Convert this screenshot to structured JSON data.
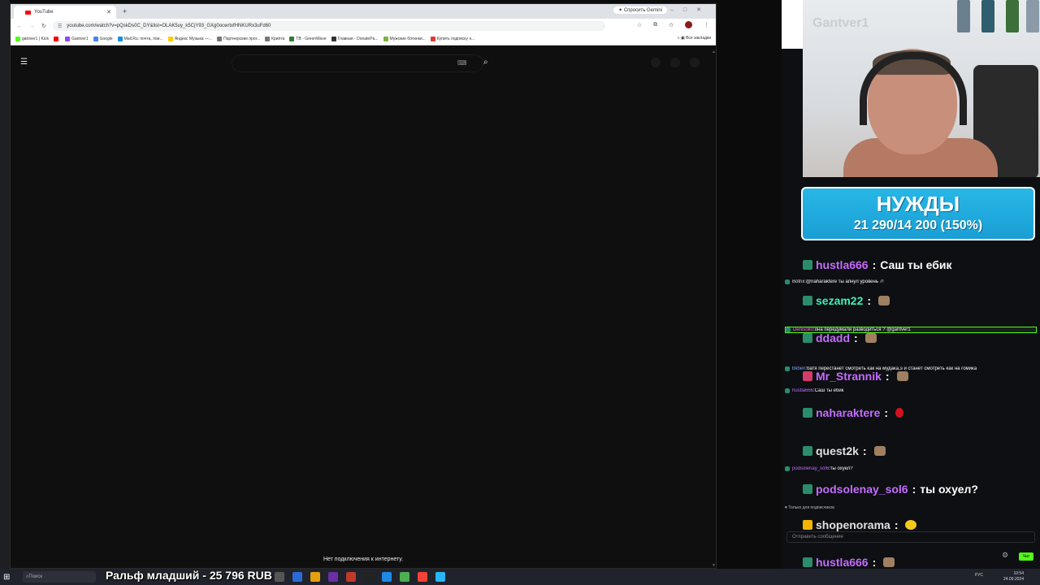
{
  "browser": {
    "tab_title": "YouTube",
    "url": "youtube.com/watch?v=pQskDs0C_DY&list=OLAK5uy_k5CjY93_GXg0ocwrtxfHNKURx3uFd60",
    "gemini_label": "Спросить Gemini",
    "all_bookmarks": "Все закладки",
    "bookmarks": [
      {
        "label": "gantver1 | Kick",
        "color": "#53fc18"
      },
      {
        "label": "",
        "color": "#ff0000"
      },
      {
        "label": "Gantver1",
        "color": "#9146ff"
      },
      {
        "label": "Google",
        "color": "#4285f4"
      },
      {
        "label": "Mail.Ru: почта, пои...",
        "color": "#168de2"
      },
      {
        "label": "Яндекс Музыка —...",
        "color": "#ffcc00"
      },
      {
        "label": "Партнерские прог...",
        "color": "#777777"
      },
      {
        "label": "Крипта",
        "color": "#777777"
      },
      {
        "label": "TB - GreenWave",
        "color": "#2e7d32"
      },
      {
        "label": "Главная - DonatePa...",
        "color": "#333333"
      },
      {
        "label": "Мужские ботинки...",
        "color": "#7cb342"
      },
      {
        "label": "Купить подписку н...",
        "color": "#e53935"
      }
    ]
  },
  "youtube": {
    "offline_message": "Нет подключения к интернету."
  },
  "stream": {
    "cam_overlay_text": "Gantver1",
    "needs_title": "НУЖДЫ",
    "needs_value": "21 290/14 200 (150%)",
    "donation_ticker_name": "Ральф младший",
    "donation_ticker_amount": "- 25 796 RUB",
    "subscribers_only": "Только для подписчиков",
    "chat_placeholder": "Отправить сообщение",
    "chat_button": "Чат"
  },
  "chat_big": [
    {
      "user": "hustla666",
      "color": "#c46bff",
      "text": "Саш ты ебик",
      "badge": "#2a8c6b"
    },
    {
      "user": "sezam22",
      "color": "#3df0b8",
      "text": "",
      "badge": "#2a8c6b"
    },
    {
      "user": "ddadd",
      "color": "#c46bff",
      "text": "",
      "badge": "#2a8c6b"
    },
    {
      "user": "Mr_Strannik",
      "color": "#c46bff",
      "text": "",
      "badge": "#d23b6a"
    },
    {
      "user": "naharaktere",
      "color": "#c46bff",
      "text": "",
      "badge": "#2a8c6b"
    },
    {
      "user": "quest2k",
      "color": "#e0e0e0",
      "text": "",
      "badge": "#2a8c6b"
    },
    {
      "user": "podsolenay_sol6",
      "color": "#c46bff",
      "text": "ты охуел?",
      "badge": "#2a8c6b"
    },
    {
      "user": "shopenorama",
      "color": "#e0e0e0",
      "text": "",
      "badge": "#f4b400"
    },
    {
      "user": "hustla666",
      "color": "#c46bff",
      "text": "",
      "badge": "#2a8c6b"
    }
  ],
  "chat_small": [
    {
      "user": "Botrix",
      "color": "#e0e0e0",
      "text": "@naharaktere ты апнул уровень 7!"
    },
    {
      "user": "Denisok0",
      "color": "#ff6ad5",
      "text": "она передумали разводиться ? @gantver1"
    },
    {
      "user": "bkben",
      "color": "#7aa8ff",
      "text": "батя перестанет смотреть как на мудака,э и станет смотреть как на гомика"
    },
    {
      "user": "hustla666",
      "color": "#c46bff",
      "text": "Саш ты ебик"
    },
    {
      "user": "podsolenay_sol6",
      "color": "#c46bff",
      "text": "ты охуел?"
    }
  ],
  "taskbar": {
    "search_placeholder": "Поиск",
    "lang": "РУС",
    "time": "10:54",
    "date": "24.09.2024"
  }
}
